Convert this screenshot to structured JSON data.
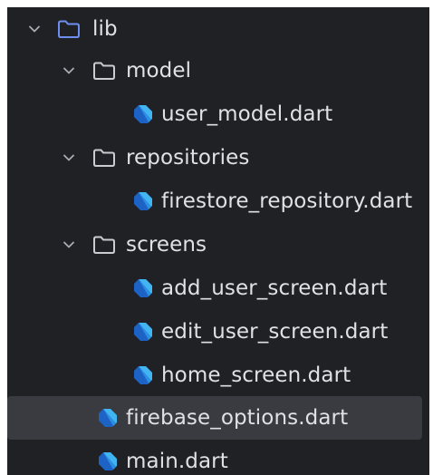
{
  "tree": {
    "root": {
      "label": "lib",
      "icon": "folder-icon",
      "expanded": true
    },
    "model": {
      "label": "model",
      "icon": "folder-icon",
      "expanded": true
    },
    "user_model": {
      "label": "user_model.dart",
      "icon": "dart-file-icon"
    },
    "repositories": {
      "label": "repositories",
      "icon": "folder-icon",
      "expanded": true
    },
    "firestore_repository": {
      "label": "firestore_repository.dart",
      "icon": "dart-file-icon"
    },
    "screens": {
      "label": "screens",
      "icon": "folder-icon",
      "expanded": true
    },
    "add_user_screen": {
      "label": "add_user_screen.dart",
      "icon": "dart-file-icon"
    },
    "edit_user_screen": {
      "label": "edit_user_screen.dart",
      "icon": "dart-file-icon"
    },
    "home_screen": {
      "label": "home_screen.dart",
      "icon": "dart-file-icon"
    },
    "firebase_options": {
      "label": "firebase_options.dart",
      "icon": "dart-file-icon",
      "selected": true
    },
    "main": {
      "label": "main.dart",
      "icon": "dart-file-icon"
    }
  },
  "colors": {
    "background": "#202124",
    "selected_row": "#393b40",
    "text": "#dfe1e5",
    "chevron": "#a8adb4",
    "root_folder": "#6f8ff0",
    "folder": "#c9ccd1",
    "dart_dark": "#1d63c6",
    "dart_light": "#40b5f2"
  }
}
